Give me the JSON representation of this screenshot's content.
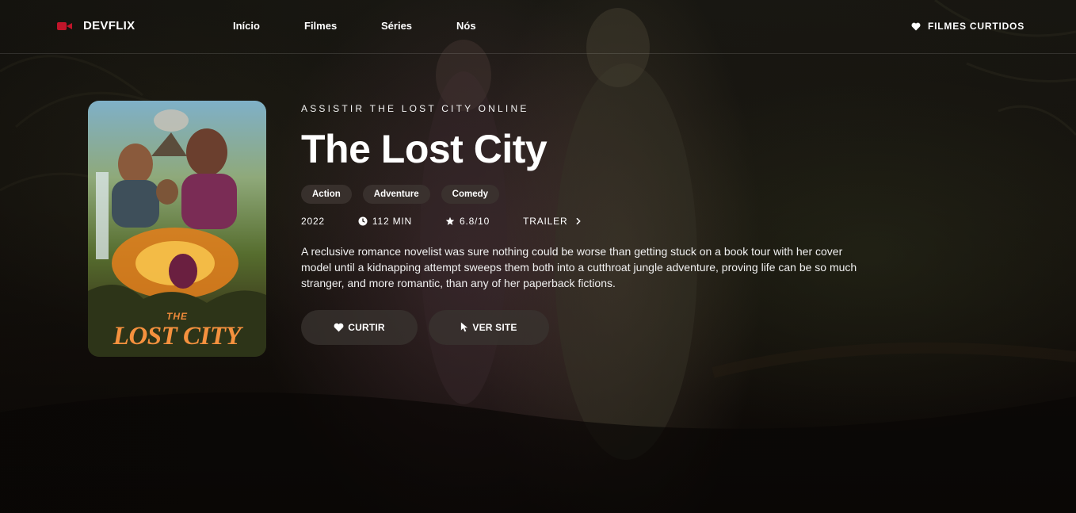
{
  "header": {
    "brand": "DEVFLIX",
    "nav": [
      {
        "label": "Início"
      },
      {
        "label": "Filmes"
      },
      {
        "label": "Séries"
      },
      {
        "label": "Nós"
      }
    ],
    "favorites_label": "FILMES CURTIDOS"
  },
  "poster": {
    "title_top": "THE",
    "title_main": "LOST CITY"
  },
  "movie": {
    "kicker": "ASSISTIR THE LOST CITY ONLINE",
    "title": "The Lost City",
    "genres": [
      "Action",
      "Adventure",
      "Comedy"
    ],
    "year": "2022",
    "runtime": "112 MIN",
    "rating": "6.8/10",
    "trailer_label": "TRAILER",
    "description": "A reclusive romance novelist was sure nothing could be worse than getting stuck on a book tour with her cover model until a kidnapping attempt sweeps them both into a cutthroat jungle adventure, proving life can be so much stranger, and more romantic, than any of her paperback fictions."
  },
  "actions": {
    "like_label": "CURTIR",
    "site_label": "VER SITE"
  },
  "colors": {
    "brand": "#c0152a",
    "background": "#0f0c09",
    "pill": "#3c3430"
  },
  "icons": {
    "logo": "video-camera-icon",
    "favorites": "heart-icon",
    "runtime": "clock-icon",
    "rating": "star-icon",
    "trailer": "chevron-right-icon",
    "like": "heart-icon",
    "site": "cursor-icon"
  }
}
